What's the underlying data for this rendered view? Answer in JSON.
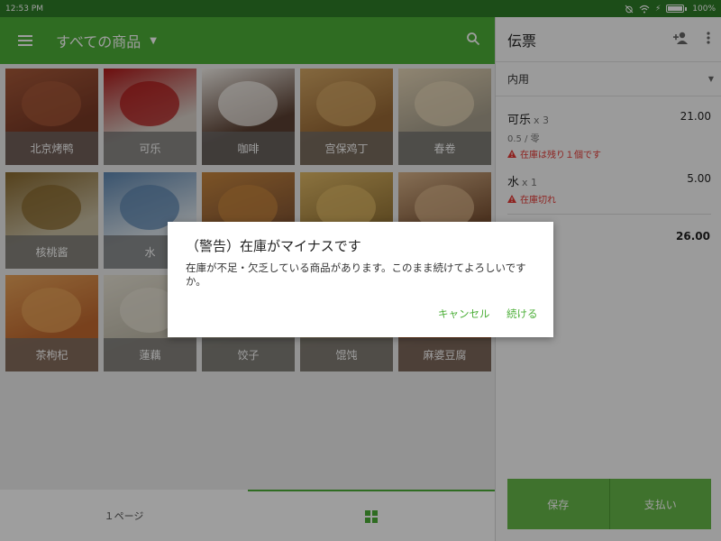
{
  "status_bar": {
    "time": "12:53 PM",
    "battery": "100%",
    "battery_level": 1.0
  },
  "header": {
    "title": "すべての商品"
  },
  "products": [
    {
      "label": "北京烤鸭",
      "bg": "#7a3a26",
      "accent": "#a85a3a"
    },
    {
      "label": "可乐",
      "bg": "#d8d0c8",
      "accent": "#b01818"
    },
    {
      "label": "咖啡",
      "bg": "#5b4032",
      "accent": "#f3efe9"
    },
    {
      "label": "宫保鸡丁",
      "bg": "#9a6a36",
      "accent": "#d5a865"
    },
    {
      "label": "春卷",
      "bg": "#a9a18e",
      "accent": "#e7d7b8"
    },
    {
      "label": "核桃酱",
      "bg": "#c9bfa3",
      "accent": "#8a6a2e"
    },
    {
      "label": "水",
      "bg": "#d8e2ea",
      "accent": "#5d87b2"
    },
    {
      "label": "",
      "bg": "#8a5a35",
      "accent": "#c8873f"
    },
    {
      "label": "",
      "bg": "#9b7a3a",
      "accent": "#e0b966"
    },
    {
      "label": "",
      "bg": "#7d5436",
      "accent": "#d9b48a"
    },
    {
      "label": "茶枸杞",
      "bg": "#c36a30",
      "accent": "#e9a45a"
    },
    {
      "label": "蓮藕",
      "bg": "#c4bfae",
      "accent": "#e8e3d5"
    },
    {
      "label": "饺子",
      "bg": "#b8b09a",
      "accent": "#e6dfca"
    },
    {
      "label": "馄饨",
      "bg": "#b8a584",
      "accent": "#e4d3a8"
    },
    {
      "label": "麻婆豆腐",
      "bg": "#a55a2e",
      "accent": "#d68a4e"
    }
  ],
  "bottom_nav": {
    "page_label": "１ページ"
  },
  "order": {
    "title": "伝票",
    "dine_option": "内用",
    "items": [
      {
        "name": "可乐",
        "qty": "x 3",
        "price": "21.00",
        "sub": "0.5 / 零",
        "warning": "在庫は残り１個です"
      },
      {
        "name": "水",
        "qty": "x 1",
        "price": "5.00",
        "warning": "在庫切れ"
      }
    ],
    "total": "26.00",
    "save_label": "保存",
    "pay_label": "支払い"
  },
  "dialog": {
    "title": "（警告）在庫がマイナスです",
    "message": "在庫が不足・欠乏している商品があります。このまま続けてよろしいですか。",
    "cancel_label": "キャンセル",
    "continue_label": "続ける"
  },
  "colors": {
    "primary": "#4caf38",
    "status_bar": "#2e7d27",
    "warning": "#e53935"
  }
}
